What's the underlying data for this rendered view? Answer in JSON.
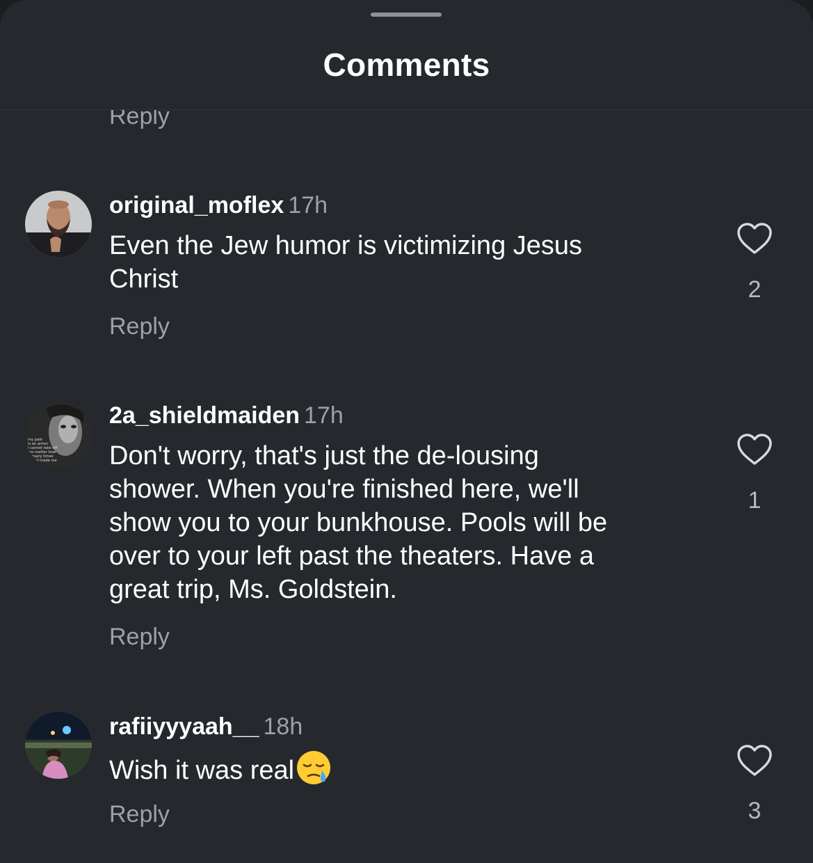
{
  "header": {
    "title": "Comments"
  },
  "partial_reply": "Reply",
  "comments": [
    {
      "username": "original_moflex",
      "time": "17h",
      "text_lines": [
        "Even the Jew humor is victimizing Jesus",
        "Christ"
      ],
      "reply_label": "Reply",
      "likes": "2"
    },
    {
      "username": "2a_shieldmaiden",
      "time": "17h",
      "text_lines": [
        "Don't worry, that's just the de-lousing",
        "shower. When you're finished here, we'll",
        "show you to your bunkhouse. Pools will be",
        "over to your left past the theaters. Have a",
        "great trip, Ms. Goldstein."
      ],
      "reply_label": "Reply",
      "likes": "1",
      "avatar_text": [
        "my past",
        "is an armor",
        "I cannot take off",
        "no matter how",
        "many times",
        "it made me"
      ]
    },
    {
      "username": "rafiiyyyaah__",
      "time": "18h",
      "text": "Wish it was real",
      "emoji": "sleepy-face-emoji",
      "reply_label": "Reply",
      "likes": "3"
    }
  ],
  "colors": {
    "background": "#25282d",
    "primary_text": "#ffffff",
    "secondary_text": "#9ea2a8"
  }
}
